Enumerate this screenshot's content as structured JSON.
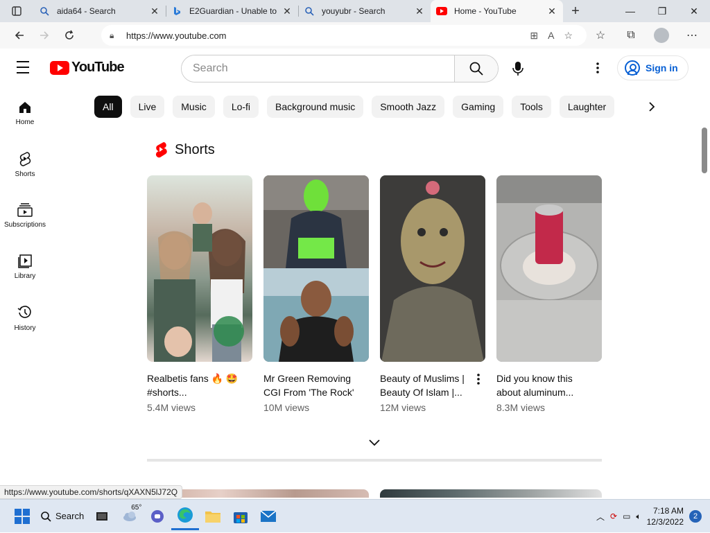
{
  "browser": {
    "tabs": [
      {
        "title": "aida64 - Search",
        "icon": "search-icon"
      },
      {
        "title": "E2Guardian - Unable to",
        "icon": "bing-icon"
      },
      {
        "title": "youyubr - Search",
        "icon": "search-icon"
      },
      {
        "title": "Home - YouTube",
        "icon": "youtube-icon",
        "active": true
      }
    ],
    "url": "https://www.youtube.com",
    "status_url": "https://www.youtube.com/shorts/qXAXN5lJ72Q"
  },
  "youtube": {
    "logo_text": "YouTube",
    "search_placeholder": "Search",
    "signin_label": "Sign in",
    "guide": [
      {
        "label": "Home",
        "icon": "home-icon"
      },
      {
        "label": "Shorts",
        "icon": "shorts-icon"
      },
      {
        "label": "Subscriptions",
        "icon": "subscriptions-icon"
      },
      {
        "label": "Library",
        "icon": "library-icon"
      },
      {
        "label": "History",
        "icon": "history-icon"
      }
    ],
    "chips": [
      "All",
      "Live",
      "Music",
      "Lo-fi",
      "Background music",
      "Smooth Jazz",
      "Gaming",
      "Tools",
      "Laughter"
    ],
    "shorts_heading": "Shorts",
    "shorts": [
      {
        "title": "Realbetis fans 🔥 🤩 #shorts...",
        "views": "5.4M views"
      },
      {
        "title": "Mr Green Removing CGI From 'The Rock'",
        "views": "10M views"
      },
      {
        "title": "Beauty of Muslims | Beauty Of Islam |...",
        "views": "12M views"
      },
      {
        "title": "Did you know this about aluminum...",
        "views": "8.3M views"
      }
    ]
  },
  "taskbar": {
    "search_label": "Search",
    "temperature": "65°",
    "time": "7:18 AM",
    "date": "12/3/2022",
    "notifications": "2"
  },
  "colors": {
    "youtube_red": "#ff0000",
    "link_blue": "#065fd4"
  }
}
